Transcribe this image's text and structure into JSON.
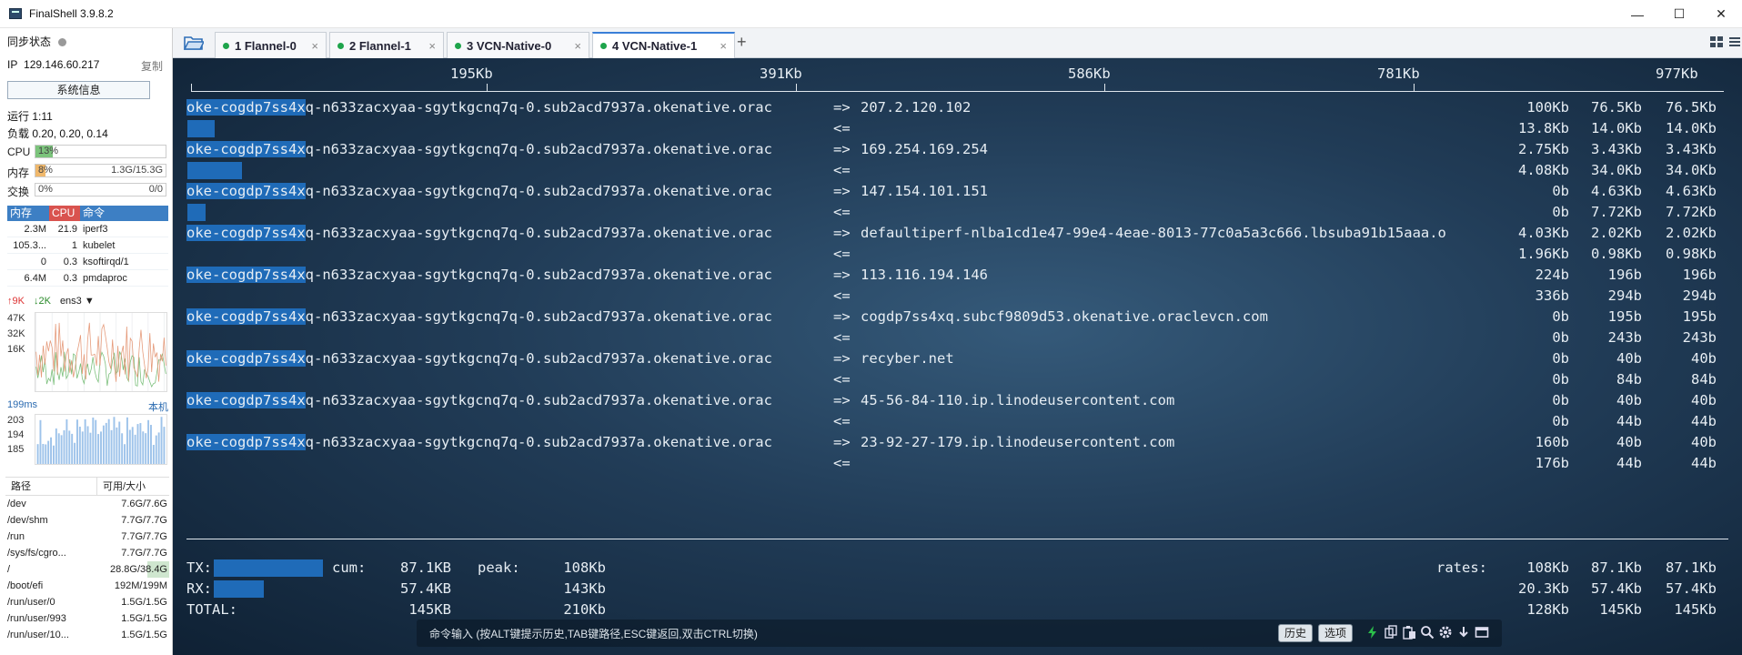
{
  "window": {
    "title": "FinalShell 3.9.8.2",
    "minimize": "—",
    "maximize": "☐",
    "close": "✕"
  },
  "sidebar": {
    "sync_label": "同步状态",
    "ip_label": "IP",
    "ip": "129.146.60.217",
    "copy": "复制",
    "sysinfo_button": "系统信息",
    "uptime": "运行 1:11",
    "load": "负载 0.20, 0.20, 0.14",
    "cpu": {
      "label": "CPU",
      "text": "13%",
      "fraction": 0.13,
      "color": "#7cc47c"
    },
    "memory": {
      "label": "内存",
      "text": "8%",
      "right": "1.3G/15.3G",
      "fraction": 0.08,
      "color": "#f0b86c"
    },
    "swap": {
      "label": "交换",
      "text": "0%",
      "right": "0/0",
      "fraction": 0.0,
      "color": "#7cc47c"
    },
    "proc_headers": [
      "内存",
      "CPU",
      "命令"
    ],
    "processes": [
      {
        "mem": "2.3M",
        "cpu": "21.9",
        "cmd": "iperf3"
      },
      {
        "mem": "105.3...",
        "cpu": "1",
        "cmd": "kubelet"
      },
      {
        "mem": "0",
        "cpu": "0.3",
        "cmd": "ksoftirqd/1"
      },
      {
        "mem": "6.4M",
        "cpu": "0.3",
        "cmd": "pmdaproc"
      }
    ],
    "net": {
      "up": "9K",
      "down": "2K",
      "iface": "ens3",
      "y_labels": [
        "47K",
        "32K",
        "16K"
      ]
    },
    "ping": {
      "latency": "199ms",
      "host": "本机",
      "y_labels": [
        "203",
        "194",
        "185"
      ]
    },
    "disk_headers": [
      "路径",
      "可用/大小"
    ],
    "disks": [
      {
        "path": "/dev",
        "size": "7.6G/7.6G"
      },
      {
        "path": "/dev/shm",
        "size": "7.7G/7.7G"
      },
      {
        "path": "/run",
        "size": "7.7G/7.7G"
      },
      {
        "path": "/sys/fs/cgro...",
        "size": "7.7G/7.7G"
      },
      {
        "path": "/",
        "size": "28.8G/38.4G"
      },
      {
        "path": "/boot/efi",
        "size": "192M/199M"
      },
      {
        "path": "/run/user/0",
        "size": "1.5G/1.5G"
      },
      {
        "path": "/run/user/993",
        "size": "1.5G/1.5G"
      },
      {
        "path": "/run/user/10...",
        "size": "1.5G/1.5G"
      }
    ]
  },
  "tabs": [
    {
      "label": "1 Flannel-0",
      "close": "×"
    },
    {
      "label": "2 Flannel-1",
      "close": "×"
    },
    {
      "label": "3 VCN-Native-0",
      "close": "×"
    },
    {
      "label": "4 VCN-Native-1",
      "close": "×"
    }
  ],
  "add_tab": "+",
  "terminal": {
    "scale": [
      "195Kb",
      "391Kb",
      "586Kb",
      "781Kb",
      "977Kb"
    ],
    "source_prefix": "oke-cogdp7ss4x",
    "source_rest": "q-n633zacxyaa-sgytkgcnq7q-0.sub2acd7937a.okenative.orac",
    "out_arrow": "=>",
    "in_arrow": "<=",
    "flows": [
      {
        "dest": "207.2.120.102",
        "out": [
          "100Kb",
          "76.5Kb",
          "76.5Kb"
        ],
        "in": [
          "13.8Kb",
          "14.0Kb",
          "14.0Kb"
        ]
      },
      {
        "dest": "169.254.169.254",
        "out": [
          "2.75Kb",
          "3.43Kb",
          "3.43Kb"
        ],
        "in": [
          "4.08Kb",
          "34.0Kb",
          "34.0Kb"
        ]
      },
      {
        "dest": "147.154.101.151",
        "out": [
          "0b",
          "4.63Kb",
          "4.63Kb"
        ],
        "in": [
          "0b",
          "7.72Kb",
          "7.72Kb"
        ]
      },
      {
        "dest": "defaultiperf-nlba1cd1e47-99e4-4eae-8013-77c0a5a3c666.lbsuba91b15aaa.o",
        "out": [
          "4.03Kb",
          "2.02Kb",
          "2.02Kb"
        ],
        "in": [
          "1.96Kb",
          "0.98Kb",
          "0.98Kb"
        ]
      },
      {
        "dest": "113.116.194.146",
        "out": [
          "224b",
          "196b",
          "196b"
        ],
        "in": [
          "336b",
          "294b",
          "294b"
        ]
      },
      {
        "dest": "cogdp7ss4xq.subcf9809d53.okenative.oraclevcn.com",
        "out": [
          "0b",
          "195b",
          "195b"
        ],
        "in": [
          "0b",
          "243b",
          "243b"
        ]
      },
      {
        "dest": "recyber.net",
        "out": [
          "0b",
          "40b",
          "40b"
        ],
        "in": [
          "0b",
          "84b",
          "84b"
        ]
      },
      {
        "dest": "45-56-84-110.ip.linodeusercontent.com",
        "out": [
          "0b",
          "40b",
          "40b"
        ],
        "in": [
          "0b",
          "44b",
          "44b"
        ]
      },
      {
        "dest": "23-92-27-179.ip.linodeusercontent.com",
        "out": [
          "160b",
          "40b",
          "40b"
        ],
        "in": [
          "176b",
          "44b",
          "44b"
        ]
      }
    ],
    "totals": {
      "tx_label": "TX:",
      "rx_label": "RX:",
      "total_label": "TOTAL:",
      "cum_label": "cum:",
      "peak_label": "peak:",
      "rates_label": "rates:",
      "tx_cum": "87.1KB",
      "tx_peak": "108Kb",
      "tx_rates": [
        "108Kb",
        "87.1Kb",
        "87.1Kb"
      ],
      "rx_cum": "57.4KB",
      "rx_peak": "143Kb",
      "rx_rates": [
        "20.3Kb",
        "57.4Kb",
        "57.4Kb"
      ],
      "total_cum": "145KB",
      "total_peak": "210Kb",
      "total_rates": [
        "128Kb",
        "145Kb",
        "145Kb"
      ]
    }
  },
  "cmdbar": {
    "hint": "命令输入 (按ALT键提示历史,TAB键路径,ESC键返回,双击CTRL切换)",
    "history": "历史",
    "options": "选项"
  }
}
